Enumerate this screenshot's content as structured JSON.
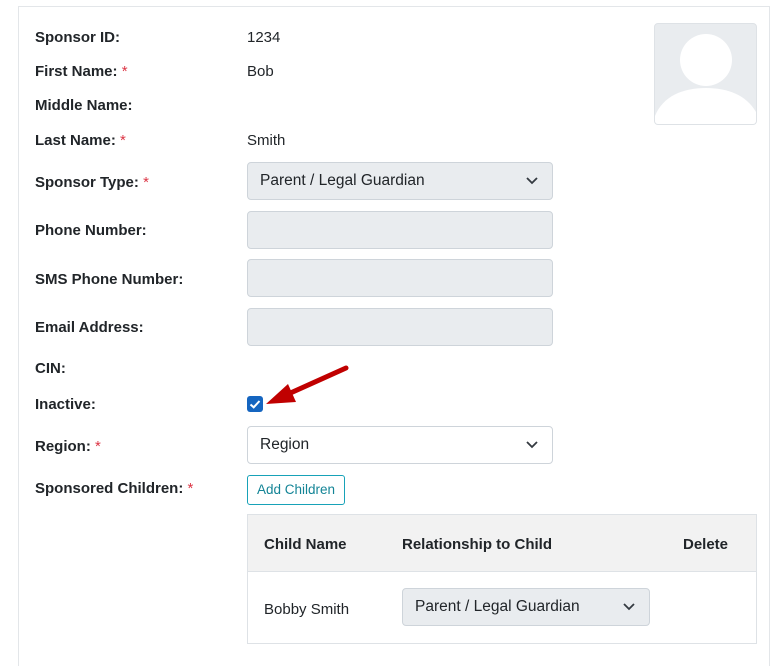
{
  "form": {
    "sponsor_id": {
      "label": "Sponsor ID:",
      "value": "1234"
    },
    "first_name": {
      "label": "First Name:",
      "required_mark": "*",
      "value": "Bob"
    },
    "middle_name": {
      "label": "Middle Name:",
      "value": ""
    },
    "last_name": {
      "label": "Last Name:",
      "required_mark": "*",
      "value": "Smith"
    },
    "sponsor_type": {
      "label": "Sponsor Type:",
      "required_mark": "*",
      "value": "Parent / Legal Guardian"
    },
    "phone_number": {
      "label": "Phone Number:",
      "value": ""
    },
    "sms_phone_number": {
      "label": "SMS Phone Number:",
      "value": ""
    },
    "email_address": {
      "label": "Email Address:",
      "value": ""
    },
    "cin": {
      "label": "CIN:",
      "value": ""
    },
    "inactive": {
      "label": "Inactive:",
      "checked": true
    },
    "region": {
      "label": "Region:",
      "required_mark": "*",
      "value": "Region"
    },
    "sponsored_children": {
      "label": "Sponsored Children:",
      "required_mark": "*",
      "add_button": "Add Children"
    }
  },
  "children_table": {
    "headers": [
      "Child Name",
      "Relationship to Child",
      "Delete"
    ],
    "rows": [
      {
        "child_name": "Bobby Smith",
        "relationship": "Parent / Legal Guardian"
      }
    ]
  },
  "icons": {
    "avatar": "user-placeholder-icon",
    "dropdown": "chevron-down-icon",
    "checkbox": "check-icon",
    "annotation": "red-arrow-icon"
  },
  "colors": {
    "required": "#dc3545",
    "checkbox": "#1565c0",
    "arrow": "#c00000",
    "button": "#17a2b8"
  }
}
